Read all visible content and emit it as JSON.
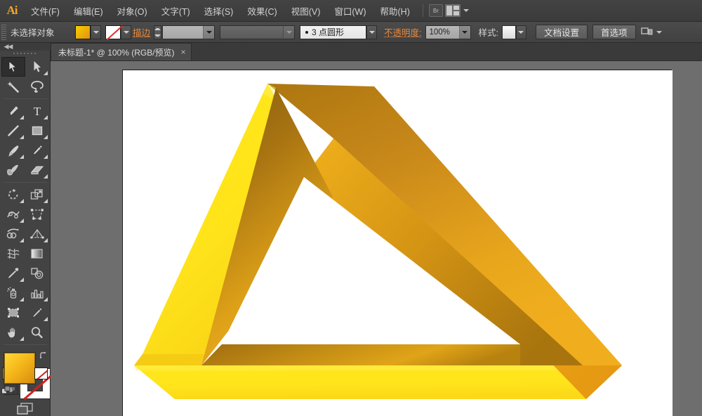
{
  "app": {
    "name": "Ai",
    "logo_color": "#f5a623"
  },
  "menubar": {
    "items": [
      {
        "label": "文件(F)",
        "name": "menu-file"
      },
      {
        "label": "编辑(E)",
        "name": "menu-edit"
      },
      {
        "label": "对象(O)",
        "name": "menu-object"
      },
      {
        "label": "文字(T)",
        "name": "menu-type"
      },
      {
        "label": "选择(S)",
        "name": "menu-select"
      },
      {
        "label": "效果(C)",
        "name": "menu-effect"
      },
      {
        "label": "视图(V)",
        "name": "menu-view"
      },
      {
        "label": "窗口(W)",
        "name": "menu-window"
      },
      {
        "label": "帮助(H)",
        "name": "menu-help"
      }
    ],
    "bridge_button": "Br",
    "workspace_switcher": "workspace-icon"
  },
  "controlbar": {
    "selection_status": "未选择对象",
    "fill_swatch": "渐变填色",
    "stroke_swatch": "无描边",
    "stroke_label": "描边",
    "stroke_weight": "",
    "stroke_weight_placeholder": "",
    "stroke_style": "",
    "stroke_profile": "3 点圆形",
    "opacity_label": "不透明度:",
    "opacity_value": "100%",
    "style_label": "样式:",
    "doc_setup_button": "文档设置",
    "preferences_button": "首选项",
    "arrange_icon": "arrange-documents-icon"
  },
  "tabbar": {
    "tab_title": "未标题-1* @ 100% (RGB/预览)",
    "close_label": "×"
  },
  "toolbox": {
    "collapse_label": "◀◀",
    "tools": [
      {
        "name": "selection-tool",
        "label": "选择工具",
        "active": true,
        "flyout": false
      },
      {
        "name": "direct-selection-tool",
        "label": "直接选择工具",
        "active": false,
        "flyout": true
      },
      {
        "name": "magic-wand-tool",
        "label": "魔棒工具",
        "active": false,
        "flyout": false
      },
      {
        "name": "lasso-tool",
        "label": "套索工具",
        "active": false,
        "flyout": false
      },
      {
        "name": "pen-tool",
        "label": "钢笔工具",
        "active": false,
        "flyout": true
      },
      {
        "name": "type-tool",
        "label": "文字工具",
        "active": false,
        "flyout": true
      },
      {
        "name": "line-segment-tool",
        "label": "直线段工具",
        "active": false,
        "flyout": true
      },
      {
        "name": "rectangle-tool",
        "label": "矩形工具",
        "active": false,
        "flyout": true
      },
      {
        "name": "paintbrush-tool",
        "label": "画笔工具",
        "active": false,
        "flyout": true
      },
      {
        "name": "pencil-tool",
        "label": "铅笔工具",
        "active": false,
        "flyout": true
      },
      {
        "name": "blob-brush-tool",
        "label": "斑点画笔工具",
        "active": false,
        "flyout": false
      },
      {
        "name": "eraser-tool",
        "label": "橡皮擦工具",
        "active": false,
        "flyout": true
      },
      {
        "name": "rotate-tool",
        "label": "旋转工具",
        "active": false,
        "flyout": true
      },
      {
        "name": "scale-tool",
        "label": "比例缩放工具",
        "active": false,
        "flyout": true
      },
      {
        "name": "width-tool",
        "label": "宽度工具",
        "active": false,
        "flyout": true
      },
      {
        "name": "free-transform-tool",
        "label": "自由变换工具",
        "active": false,
        "flyout": false
      },
      {
        "name": "shape-builder-tool",
        "label": "形状生成器工具",
        "active": false,
        "flyout": true
      },
      {
        "name": "perspective-grid-tool",
        "label": "透视网格工具",
        "active": false,
        "flyout": true
      },
      {
        "name": "mesh-tool",
        "label": "网格工具",
        "active": false,
        "flyout": false
      },
      {
        "name": "gradient-tool",
        "label": "渐变工具",
        "active": false,
        "flyout": false
      },
      {
        "name": "eyedropper-tool",
        "label": "吸管工具",
        "active": false,
        "flyout": true
      },
      {
        "name": "blend-tool",
        "label": "混合工具",
        "active": false,
        "flyout": false
      },
      {
        "name": "symbol-sprayer-tool",
        "label": "符号喷枪工具",
        "active": false,
        "flyout": true
      },
      {
        "name": "column-graph-tool",
        "label": "柱形图工具",
        "active": false,
        "flyout": true
      },
      {
        "name": "artboard-tool",
        "label": "画板工具",
        "active": false,
        "flyout": false
      },
      {
        "name": "slice-tool",
        "label": "切片工具",
        "active": false,
        "flyout": true
      },
      {
        "name": "hand-tool",
        "label": "抓手工具",
        "active": false,
        "flyout": true
      },
      {
        "name": "zoom-tool",
        "label": "缩放工具",
        "active": false,
        "flyout": false
      }
    ],
    "fill_color": "#f5b81a",
    "stroke_color": "#ffffff",
    "stroke_is_none": true,
    "fill_stroke_chips": [
      {
        "name": "color-chip",
        "label": "颜色"
      },
      {
        "name": "gradient-chip",
        "label": "渐变"
      },
      {
        "name": "none-chip",
        "label": "无"
      }
    ],
    "draw_modes": [
      {
        "name": "draw-normal-mode",
        "label": "正常绘图",
        "on": false
      },
      {
        "name": "draw-behind-mode",
        "label": "背面绘图",
        "on": true
      },
      {
        "name": "draw-inside-mode",
        "label": "内部绘图",
        "on": false
      }
    ],
    "screen_mode": "更改屏幕模式"
  },
  "canvas": {
    "zoom_level": "100%",
    "color_mode": "RGB",
    "view_mode": "预览",
    "background": "#6e6e6e",
    "artboard_background": "#ffffff"
  },
  "artwork": {
    "title": "彭罗斯不可能三角形",
    "type": "penrose-triangle",
    "colors": {
      "bright_yellow": "#ffe81c",
      "yellow": "#fcd31a",
      "gold": "#f0a81a",
      "amber": "#e09a16",
      "dark_gold": "#b07a12",
      "deep_brown": "#9a6a10",
      "highlight": "#fff45a"
    },
    "faces": [
      {
        "name": "left-outer-face",
        "gradient": [
          "#ffe81c",
          "#f8d018"
        ]
      },
      {
        "name": "bottom-front-face",
        "gradient": [
          "#ffe81c",
          "#fcd91c"
        ]
      },
      {
        "name": "right-outer-face",
        "gradient": [
          "#f3b018",
          "#e79c14"
        ]
      },
      {
        "name": "top-right-bevel",
        "gradient": [
          "#b37c12",
          "#e8a418"
        ]
      },
      {
        "name": "inner-left-face",
        "gradient": [
          "#8d6310",
          "#f0b41c"
        ]
      },
      {
        "name": "inner-bottom-face",
        "gradient": [
          "#a06c10",
          "#e8aa18"
        ]
      },
      {
        "name": "inner-right-face",
        "gradient": [
          "#e8a818",
          "#a87412"
        ]
      }
    ]
  }
}
